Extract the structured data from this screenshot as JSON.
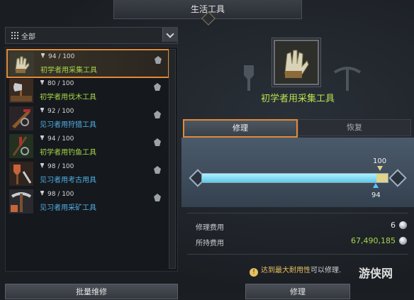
{
  "window": {
    "title": "生活工具"
  },
  "filter": {
    "selected": "全部"
  },
  "tools": [
    {
      "durability": "94 / 100",
      "name": "初学者用采集工具",
      "color": "green",
      "icon": "gloves-icon",
      "selected": true
    },
    {
      "durability": "80 / 100",
      "name": "初学者用伐木工具",
      "color": "green",
      "icon": "axe-icon",
      "selected": false
    },
    {
      "durability": "92 / 100",
      "name": "见习者用狩猎工具",
      "color": "blue",
      "icon": "musket-icon",
      "selected": false
    },
    {
      "durability": "94 / 100",
      "name": "初学者用钓鱼工具",
      "color": "green",
      "icon": "fishing-rod-icon",
      "selected": false
    },
    {
      "durability": "98 / 100",
      "name": "见习者用考古用具",
      "color": "blue",
      "icon": "shovel-icon",
      "selected": false
    },
    {
      "durability": "98 / 100",
      "name": "见习者用采矿工具",
      "color": "blue",
      "icon": "pickaxe-icon",
      "selected": false
    }
  ],
  "bulk_repair_label": "批量维修",
  "detail": {
    "title": "初学者用采集工具",
    "tabs": {
      "repair": "修理",
      "restore": "恢复"
    },
    "durability_max": 100,
    "durability_current": 94,
    "max_label": "100",
    "current_label": "94",
    "repair_cost_label": "修理费用",
    "repair_cost": "6",
    "owned_label": "所持费用",
    "owned": "67,490,185",
    "notice_highlight": "达到最大耐用性",
    "notice_rest": "可以修理.",
    "repair_button": "修理"
  },
  "watermark": "游侠网",
  "colors": {
    "green": "#a6d64a",
    "blue": "#4fb0e8",
    "accent": "#e08a3a"
  }
}
